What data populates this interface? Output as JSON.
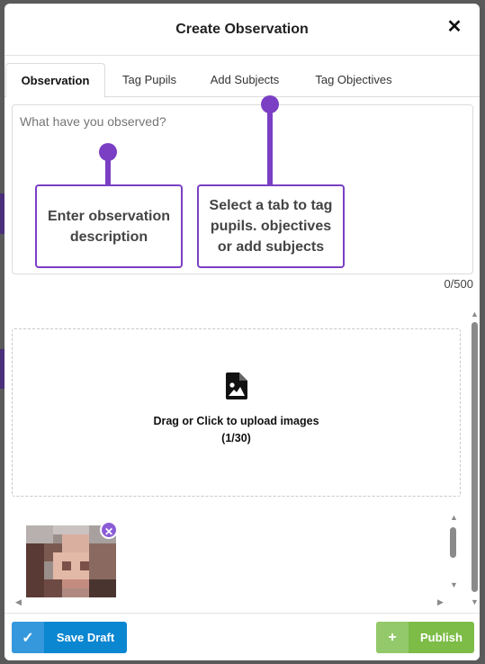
{
  "modal": {
    "title": "Create Observation",
    "close_symbol": "✕"
  },
  "tabs": [
    {
      "label": "Observation",
      "active": true
    },
    {
      "label": "Tag Pupils",
      "active": false
    },
    {
      "label": "Add Subjects",
      "active": false
    },
    {
      "label": "Tag Objectives",
      "active": false
    }
  ],
  "observation": {
    "placeholder": "What have you observed?",
    "counter": "0/500"
  },
  "callouts": {
    "description": "Enter observation description",
    "tabs_hint": "Select a tab to tag pupils. objectives or add subjects"
  },
  "upload": {
    "line1": "Drag or Click to upload images",
    "line2": "(1/30)",
    "icon": "image-file-icon"
  },
  "gallery": {
    "remove_symbol": "✕"
  },
  "footer": {
    "save_label": "Save Draft",
    "save_icon": "✓",
    "publish_label": "Publish",
    "publish_icon": "+"
  },
  "colors": {
    "accent_purple": "#7b3fc4",
    "save_blue": "#0b86d0",
    "publish_green": "#7cbc47"
  }
}
